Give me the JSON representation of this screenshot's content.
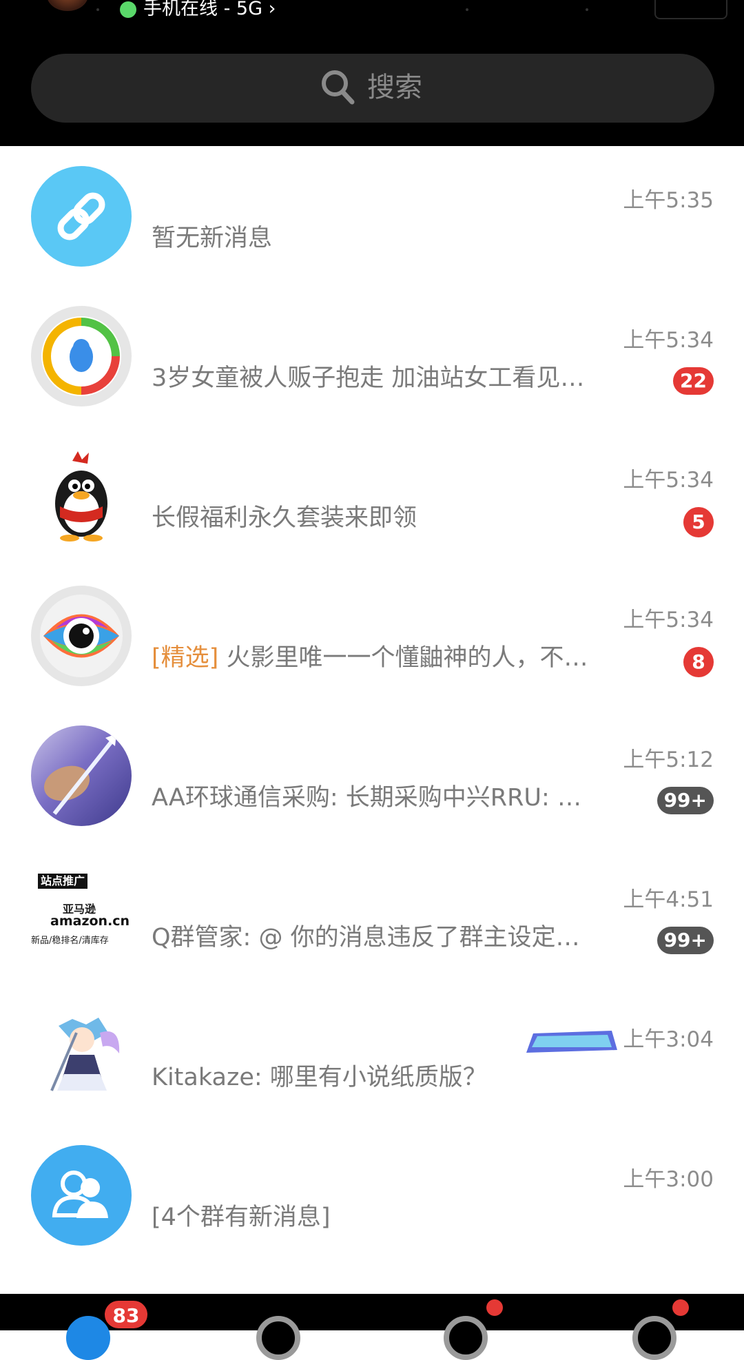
{
  "status": {
    "text": "手机在线 - 5G"
  },
  "search": {
    "placeholder": "搜索"
  },
  "conversations": [
    {
      "time": "上午5:35",
      "preview": "暂无新消息",
      "badge": ""
    },
    {
      "time": "上午5:34",
      "preview": "3岁女童被人贩子抱走 加油站女工看见…",
      "badge": "22"
    },
    {
      "time": "上午5:34",
      "preview": "长假福利永久套装来即领",
      "badge": "5"
    },
    {
      "time": "上午5:34",
      "tag": "[精选]",
      "preview": "火影里唯一一个懂鼬神的人，不…",
      "badge": "8"
    },
    {
      "time": "上午5:12",
      "preview": "AA环球通信采购: 长期采购中兴RRU: …",
      "badge": "99+"
    },
    {
      "time": "上午4:51",
      "preview": "Q群管家: @ 你的消息违反了群主设定…",
      "badge": "99+",
      "avatar_text": [
        "站点推广",
        "亚马逊",
        "amazon.cn",
        "新品/稳排名/清库存"
      ]
    },
    {
      "time": "上午3:04",
      "preview": "Kitakaze: 哪里有小说纸质版？",
      "badge": ""
    },
    {
      "time": "上午3:00",
      "preview": "[4个群有新消息]",
      "badge": ""
    }
  ],
  "tabbar": {
    "messages_badge": "83"
  },
  "icons": [
    "search-icon",
    "link-icon",
    "tencent-news-icon",
    "qq-penguin-icon",
    "eye-icon",
    "contacts-icon"
  ],
  "colors": {
    "accent_red": "#e53935",
    "tag_orange": "#e58f3d",
    "link_blue": "#5ac8f5"
  }
}
